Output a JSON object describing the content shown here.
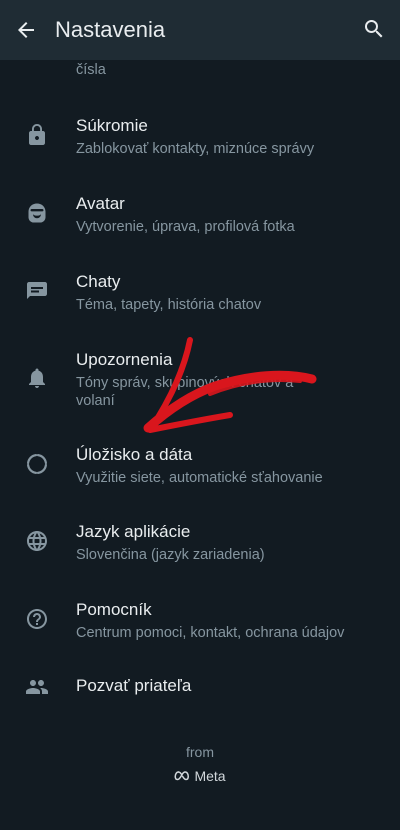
{
  "header": {
    "title": "Nastavenia"
  },
  "partial_item": {
    "sub": "čísla"
  },
  "items": [
    {
      "label": "Súkromie",
      "sub": "Zablokovať kontakty, miznúce správy",
      "icon": "lock-icon"
    },
    {
      "label": "Avatar",
      "sub": "Vytvorenie, úprava, profilová fotka",
      "icon": "avatar-icon"
    },
    {
      "label": "Chaty",
      "sub": "Téma, tapety, história chatov",
      "icon": "chat-icon"
    },
    {
      "label": "Upozornenia",
      "sub": "Tóny správ, skupinových chatov a volaní",
      "icon": "bell-icon"
    },
    {
      "label": "Úložisko a dáta",
      "sub": "Využitie siete, automatické sťahovanie",
      "icon": "storage-icon"
    },
    {
      "label": "Jazyk aplikácie",
      "sub": "Slovenčina (jazyk zariadenia)",
      "icon": "globe-icon"
    },
    {
      "label": "Pomocník",
      "sub": "Centrum pomoci, kontakt, ochrana údajov",
      "icon": "help-icon"
    },
    {
      "label": "Pozvať priateľa",
      "sub": "",
      "icon": "people-icon"
    }
  ],
  "footer": {
    "from": "from",
    "brand": "Meta"
  },
  "colors": {
    "background": "#121b22",
    "appbar": "#1f2c34",
    "primary_text": "#e9edef",
    "secondary_text": "#8696a0",
    "icon": "#8696a0",
    "annotation_arrow": "#d9161d"
  }
}
